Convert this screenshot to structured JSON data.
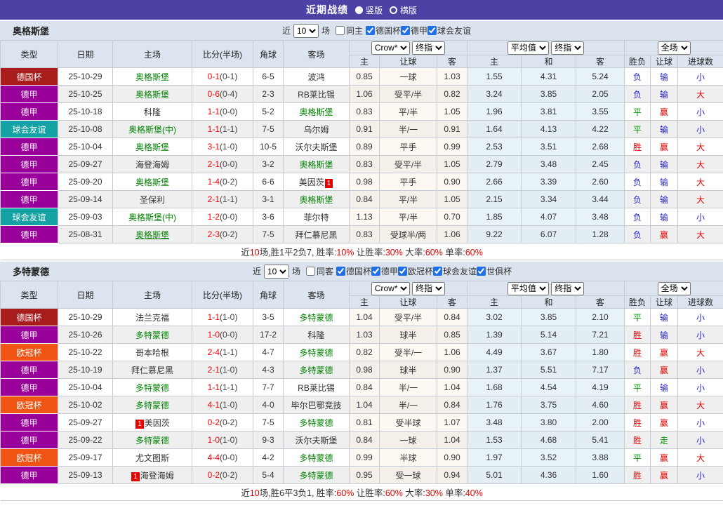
{
  "title_bar": {
    "title": "近期战绩",
    "options": [
      {
        "label": "竖版",
        "selected": true
      },
      {
        "label": "横版",
        "selected": false
      }
    ]
  },
  "columns": {
    "type": "类型",
    "date": "日期",
    "home": "主场",
    "score": "比分(半场)",
    "corner": "角球",
    "away": "客场",
    "group1_select": "Crow*",
    "group1_select2": "终指",
    "g1_home": "主",
    "g1_handicap": "让球",
    "g1_away": "客",
    "group2_select": "平均值",
    "group2_select2": "终指",
    "g2_home": "主",
    "g2_draw": "和",
    "g2_away": "客",
    "group3_select": "全场",
    "g3_result": "胜负",
    "g3_handicap": "让球",
    "g3_goals": "进球数"
  },
  "colors": {
    "title_bar": "#4c41a4",
    "section_bar": "#dbe3ee",
    "type_cup": "#a81c1c",
    "type_league": "#990099",
    "type_friendly": "#13a3a3",
    "type_ucl": "#f05513",
    "win_red": "#e60000",
    "draw_green": "#009900",
    "lose_blue": "#2525cd",
    "team_link_green": "#008000",
    "score_red": "#ff0000",
    "crow_col_bg": "#fdf9f2",
    "avg_col_bg": "#e7f2f9"
  },
  "sections": [
    {
      "team": "奥格斯堡",
      "filter": {
        "near": "近",
        "count": "10",
        "games": "场",
        "same": "同主",
        "same_checked": false,
        "leagues": [
          "德国杯",
          "德甲",
          "球会友谊"
        ]
      },
      "rows": [
        {
          "type": "德国杯",
          "tc": "cup",
          "date": "25-10-29",
          "home": "奥格斯堡",
          "home_cls": "team",
          "score": "0-1",
          "half": "(0-1)",
          "corner": "6-5",
          "away": "波鸿",
          "away_cls": "",
          "o1": "0.85",
          "hcp": "一球",
          "o2": "1.03",
          "a1": "1.55",
          "a2": "4.31",
          "a3": "5.24",
          "res": "负",
          "res_c": "blue",
          "rh": "输",
          "rh_c": "blue",
          "g": "小",
          "g_c": "blue"
        },
        {
          "type": "德甲",
          "tc": "league",
          "date": "25-10-25",
          "home": "奥格斯堡",
          "home_cls": "team",
          "score": "0-6",
          "half": "(0-4)",
          "corner": "2-3",
          "away": "RB莱比锡",
          "away_cls": "",
          "o1": "1.06",
          "hcp": "受平/半",
          "o2": "0.82",
          "a1": "3.24",
          "a2": "3.85",
          "a3": "2.05",
          "res": "负",
          "res_c": "blue",
          "rh": "输",
          "rh_c": "blue",
          "g": "大",
          "g_c": "red"
        },
        {
          "type": "德甲",
          "tc": "league",
          "date": "25-10-18",
          "home": "科隆",
          "home_cls": "",
          "score": "1-1",
          "half": "(0-0)",
          "corner": "5-2",
          "away": "奥格斯堡",
          "away_cls": "team",
          "o1": "0.83",
          "hcp": "平/半",
          "o2": "1.05",
          "a1": "1.96",
          "a2": "3.81",
          "a3": "3.55",
          "res": "平",
          "res_c": "green",
          "rh": "赢",
          "rh_c": "red",
          "g": "小",
          "g_c": "blue"
        },
        {
          "type": "球会友谊",
          "tc": "friendly",
          "date": "25-10-08",
          "home": "奥格斯堡(中)",
          "home_cls": "team",
          "score": "1-1",
          "half": "(1-1)",
          "corner": "7-5",
          "away": "乌尔姆",
          "away_cls": "",
          "o1": "0.91",
          "hcp": "半/一",
          "o2": "0.91",
          "a1": "1.64",
          "a2": "4.13",
          "a3": "4.22",
          "res": "平",
          "res_c": "green",
          "rh": "输",
          "rh_c": "blue",
          "g": "小",
          "g_c": "blue"
        },
        {
          "type": "德甲",
          "tc": "league",
          "date": "25-10-04",
          "home": "奥格斯堡",
          "home_cls": "team",
          "score": "3-1",
          "half": "(1-0)",
          "corner": "10-5",
          "away": "沃尔夫斯堡",
          "away_cls": "",
          "o1": "0.89",
          "hcp": "平手",
          "o2": "0.99",
          "a1": "2.53",
          "a2": "3.51",
          "a3": "2.68",
          "res": "胜",
          "res_c": "red",
          "rh": "赢",
          "rh_c": "red",
          "g": "大",
          "g_c": "red"
        },
        {
          "type": "德甲",
          "tc": "league",
          "date": "25-09-27",
          "home": "海登海姆",
          "home_cls": "",
          "score": "2-1",
          "half": "(0-0)",
          "corner": "3-2",
          "away": "奥格斯堡",
          "away_cls": "team",
          "o1": "0.83",
          "hcp": "受平/半",
          "o2": "1.05",
          "a1": "2.79",
          "a2": "3.48",
          "a3": "2.45",
          "res": "负",
          "res_c": "blue",
          "rh": "输",
          "rh_c": "blue",
          "g": "大",
          "g_c": "red"
        },
        {
          "type": "德甲",
          "tc": "league",
          "date": "25-09-20",
          "home": "奥格斯堡",
          "home_cls": "team",
          "score": "1-4",
          "half": "(0-2)",
          "corner": "6-6",
          "away": "美因茨",
          "away_cls": "",
          "away_badge": "1",
          "away_badge_pos": "post",
          "o1": "0.98",
          "hcp": "平手",
          "o2": "0.90",
          "a1": "2.66",
          "a2": "3.39",
          "a3": "2.60",
          "res": "负",
          "res_c": "blue",
          "rh": "输",
          "rh_c": "blue",
          "g": "大",
          "g_c": "red"
        },
        {
          "type": "德甲",
          "tc": "league",
          "date": "25-09-14",
          "home": "圣保利",
          "home_cls": "",
          "score": "2-1",
          "half": "(1-1)",
          "corner": "3-1",
          "away": "奥格斯堡",
          "away_cls": "team",
          "o1": "0.84",
          "hcp": "平/半",
          "o2": "1.05",
          "a1": "2.15",
          "a2": "3.34",
          "a3": "3.44",
          "res": "负",
          "res_c": "blue",
          "rh": "输",
          "rh_c": "blue",
          "g": "大",
          "g_c": "red"
        },
        {
          "type": "球会友谊",
          "tc": "friendly",
          "date": "25-09-03",
          "home": "奥格斯堡(中)",
          "home_cls": "team",
          "score": "1-2",
          "half": "(0-0)",
          "corner": "3-6",
          "away": "菲尔特",
          "away_cls": "",
          "o1": "1.13",
          "hcp": "平/半",
          "o2": "0.70",
          "a1": "1.85",
          "a2": "4.07",
          "a3": "3.48",
          "res": "负",
          "res_c": "blue",
          "rh": "输",
          "rh_c": "blue",
          "g": "小",
          "g_c": "blue"
        },
        {
          "type": "德甲",
          "tc": "league",
          "date": "25-08-31",
          "home": "奥格斯堡",
          "home_cls": "team underline",
          "score": "2-3",
          "half": "(0-2)",
          "corner": "7-5",
          "away": "拜仁慕尼黑",
          "away_cls": "",
          "o1": "0.83",
          "hcp": "受球半/两",
          "o2": "1.06",
          "a1": "9.22",
          "a2": "6.07",
          "a3": "1.28",
          "res": "负",
          "res_c": "blue",
          "rh": "赢",
          "rh_c": "red",
          "g": "大",
          "g_c": "red"
        }
      ],
      "summary": [
        [
          "近",
          0
        ],
        [
          "10",
          1
        ],
        [
          "场,胜1平2负7, 胜率:",
          0
        ],
        [
          "10%",
          1
        ],
        [
          " 让胜率:",
          0
        ],
        [
          "30%",
          1
        ],
        [
          " 大率:",
          0
        ],
        [
          "60%",
          1
        ],
        [
          " 单率:",
          0
        ],
        [
          "60%",
          1
        ]
      ]
    },
    {
      "team": "多特蒙德",
      "filter": {
        "near": "近",
        "count": "10",
        "games": "场",
        "same": "同客",
        "same_checked": false,
        "leagues": [
          "德国杯",
          "德甲",
          "欧冠杯",
          "球会友谊",
          "世俱杯"
        ]
      },
      "rows": [
        {
          "type": "德国杯",
          "tc": "cup",
          "date": "25-10-29",
          "home": "法兰克福",
          "home_cls": "",
          "score": "1-1",
          "half": "(1-0)",
          "corner": "3-5",
          "away": "多特蒙德",
          "away_cls": "team",
          "o1": "1.04",
          "hcp": "受平/半",
          "o2": "0.84",
          "a1": "3.02",
          "a2": "3.85",
          "a3": "2.10",
          "res": "平",
          "res_c": "green",
          "rh": "输",
          "rh_c": "blue",
          "g": "小",
          "g_c": "blue"
        },
        {
          "type": "德甲",
          "tc": "league",
          "date": "25-10-26",
          "home": "多特蒙德",
          "home_cls": "team",
          "score": "1-0",
          "half": "(0-0)",
          "corner": "17-2",
          "away": "科隆",
          "away_cls": "",
          "o1": "1.03",
          "hcp": "球半",
          "o2": "0.85",
          "a1": "1.39",
          "a2": "5.14",
          "a3": "7.21",
          "res": "胜",
          "res_c": "red",
          "rh": "输",
          "rh_c": "blue",
          "g": "小",
          "g_c": "blue"
        },
        {
          "type": "欧冠杯",
          "tc": "ucl",
          "date": "25-10-22",
          "home": "哥本哈根",
          "home_cls": "",
          "score": "2-4",
          "half": "(1-1)",
          "corner": "4-7",
          "away": "多特蒙德",
          "away_cls": "team",
          "o1": "0.82",
          "hcp": "受半/一",
          "o2": "1.06",
          "a1": "4.49",
          "a2": "3.67",
          "a3": "1.80",
          "res": "胜",
          "res_c": "red",
          "rh": "赢",
          "rh_c": "red",
          "g": "大",
          "g_c": "red"
        },
        {
          "type": "德甲",
          "tc": "league",
          "date": "25-10-19",
          "home": "拜仁慕尼黑",
          "home_cls": "",
          "score": "2-1",
          "half": "(1-0)",
          "corner": "4-3",
          "away": "多特蒙德",
          "away_cls": "team",
          "o1": "0.98",
          "hcp": "球半",
          "o2": "0.90",
          "a1": "1.37",
          "a2": "5.51",
          "a3": "7.17",
          "res": "负",
          "res_c": "blue",
          "rh": "赢",
          "rh_c": "red",
          "g": "小",
          "g_c": "blue"
        },
        {
          "type": "德甲",
          "tc": "league",
          "date": "25-10-04",
          "home": "多特蒙德",
          "home_cls": "team",
          "score": "1-1",
          "half": "(1-1)",
          "corner": "7-7",
          "away": "RB莱比锡",
          "away_cls": "",
          "o1": "0.84",
          "hcp": "半/一",
          "o2": "1.04",
          "a1": "1.68",
          "a2": "4.54",
          "a3": "4.19",
          "res": "平",
          "res_c": "green",
          "rh": "输",
          "rh_c": "blue",
          "g": "小",
          "g_c": "blue"
        },
        {
          "type": "欧冠杯",
          "tc": "ucl",
          "date": "25-10-02",
          "home": "多特蒙德",
          "home_cls": "team",
          "score": "4-1",
          "half": "(1-0)",
          "corner": "4-0",
          "away": "毕尔巴鄂竞技",
          "away_cls": "",
          "o1": "1.04",
          "hcp": "半/一",
          "o2": "0.84",
          "a1": "1.76",
          "a2": "3.75",
          "a3": "4.60",
          "res": "胜",
          "res_c": "red",
          "rh": "赢",
          "rh_c": "red",
          "g": "大",
          "g_c": "red"
        },
        {
          "type": "德甲",
          "tc": "league",
          "date": "25-09-27",
          "home": "美因茨",
          "home_cls": "",
          "home_badge": "1",
          "home_badge_pos": "pre",
          "score": "0-2",
          "half": "(0-2)",
          "corner": "7-5",
          "away": "多特蒙德",
          "away_cls": "team",
          "o1": "0.81",
          "hcp": "受半球",
          "o2": "1.07",
          "a1": "3.48",
          "a2": "3.80",
          "a3": "2.00",
          "res": "胜",
          "res_c": "red",
          "rh": "赢",
          "rh_c": "red",
          "g": "小",
          "g_c": "blue"
        },
        {
          "type": "德甲",
          "tc": "league",
          "date": "25-09-22",
          "home": "多特蒙德",
          "home_cls": "team",
          "score": "1-0",
          "half": "(1-0)",
          "corner": "9-3",
          "away": "沃尔夫斯堡",
          "away_cls": "",
          "o1": "0.84",
          "hcp": "一球",
          "o2": "1.04",
          "a1": "1.53",
          "a2": "4.68",
          "a3": "5.41",
          "res": "胜",
          "res_c": "red",
          "rh": "走",
          "rh_c": "green",
          "g": "小",
          "g_c": "blue"
        },
        {
          "type": "欧冠杯",
          "tc": "ucl",
          "date": "25-09-17",
          "home": "尤文图斯",
          "home_cls": "",
          "score": "4-4",
          "half": "(0-0)",
          "corner": "4-2",
          "away": "多特蒙德",
          "away_cls": "team",
          "o1": "0.99",
          "hcp": "半球",
          "o2": "0.90",
          "a1": "1.97",
          "a2": "3.52",
          "a3": "3.88",
          "res": "平",
          "res_c": "green",
          "rh": "赢",
          "rh_c": "red",
          "g": "大",
          "g_c": "red"
        },
        {
          "type": "德甲",
          "tc": "league",
          "date": "25-09-13",
          "home": "海登海姆",
          "home_cls": "",
          "home_badge": "1",
          "home_badge_pos": "pre",
          "score": "0-2",
          "half": "(0-2)",
          "corner": "5-4",
          "away": "多特蒙德",
          "away_cls": "team",
          "o1": "0.95",
          "hcp": "受一球",
          "o2": "0.94",
          "a1": "5.01",
          "a2": "4.36",
          "a3": "1.60",
          "res": "胜",
          "res_c": "red",
          "rh": "赢",
          "rh_c": "red",
          "g": "小",
          "g_c": "blue"
        }
      ],
      "summary": [
        [
          "近",
          0
        ],
        [
          "10",
          1
        ],
        [
          "场,胜6平3负1, 胜率:",
          0
        ],
        [
          "60%",
          1
        ],
        [
          " 让胜率:",
          0
        ],
        [
          "60%",
          1
        ],
        [
          " 大率:",
          0
        ],
        [
          "30%",
          1
        ],
        [
          " 单率:",
          0
        ],
        [
          "40%",
          1
        ]
      ]
    }
  ]
}
